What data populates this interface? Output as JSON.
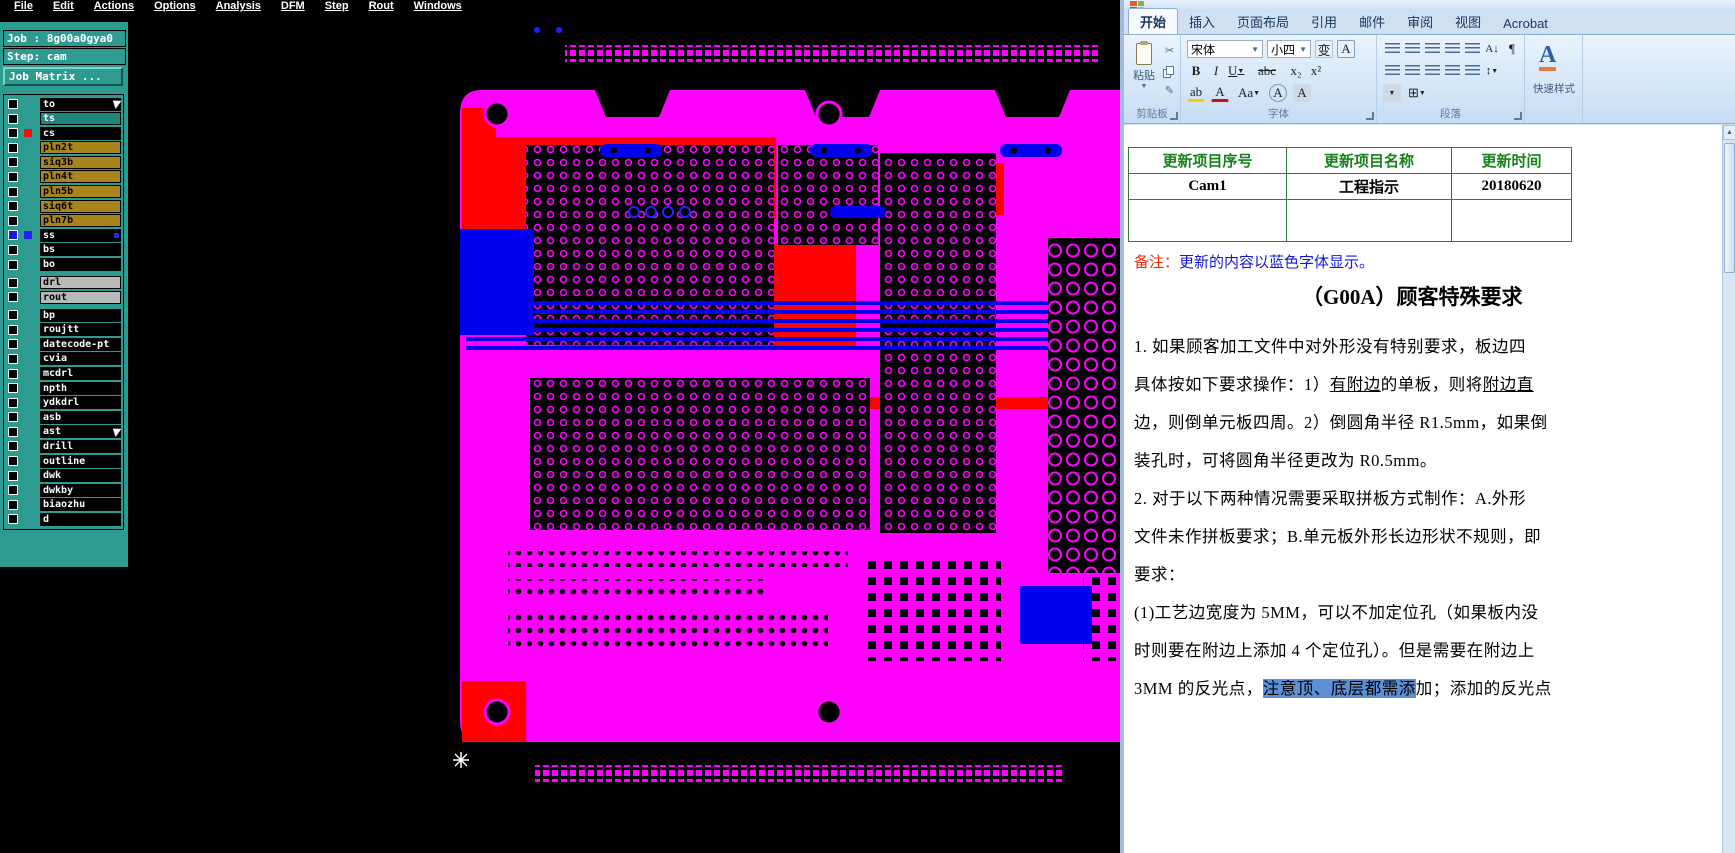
{
  "cam": {
    "menus": [
      "File",
      "Edit",
      "Actions",
      "Options",
      "Analysis",
      "DFM",
      "Step",
      "Rout",
      "Windows"
    ],
    "job": {
      "job_line": "Job : 8g00a0gya0",
      "step_line": "Step: cam",
      "matrix_label": "Job Matrix ..."
    },
    "layers": [
      {
        "name": "to",
        "type": "black",
        "cursor": true
      },
      {
        "name": "ts",
        "type": "teal"
      },
      {
        "name": "cs",
        "type": "black",
        "marker": true
      },
      {
        "name": "pln2t",
        "type": "gold"
      },
      {
        "name": "siq3b",
        "type": "gold"
      },
      {
        "name": "pln4t",
        "type": "gold"
      },
      {
        "name": "pln5b",
        "type": "gold"
      },
      {
        "name": "siq6t",
        "type": "gold"
      },
      {
        "name": "pln7b",
        "type": "gold"
      },
      {
        "name": "ss",
        "type": "black",
        "selected": true
      },
      {
        "name": "bs",
        "type": "black"
      },
      {
        "name": "bo",
        "type": "black"
      },
      {
        "name": "drl",
        "type": "gray",
        "gap": true
      },
      {
        "name": "rout",
        "type": "gray"
      },
      {
        "name": "bp",
        "type": "black",
        "gap": true
      },
      {
        "name": "roujtt",
        "type": "black"
      },
      {
        "name": "datecode-pt",
        "type": "black"
      },
      {
        "name": "cvia",
        "type": "black"
      },
      {
        "name": "mcdrl",
        "type": "black"
      },
      {
        "name": "npth",
        "type": "black"
      },
      {
        "name": "ydkdrl",
        "type": "black"
      },
      {
        "name": "asb",
        "type": "black"
      },
      {
        "name": "ast",
        "type": "black",
        "cursor": true
      },
      {
        "name": "drill",
        "type": "black"
      },
      {
        "name": "outline",
        "type": "black"
      },
      {
        "name": "dwk",
        "type": "black"
      },
      {
        "name": "dwkby",
        "type": "black"
      },
      {
        "name": "biaozhu",
        "type": "black"
      },
      {
        "name": "d",
        "type": "black"
      }
    ],
    "colors": {
      "sidebar_teal": "#2d9b8f",
      "layer_gold": "#a8851c",
      "layer_gray": "#b9b9b9",
      "pcb_magenta": "#ff00ff",
      "pcb_red": "#ff0000",
      "pcb_blue": "#0000ee"
    }
  },
  "word": {
    "tabs": [
      {
        "label": "开始",
        "active": true
      },
      {
        "label": "插入"
      },
      {
        "label": "页面布局"
      },
      {
        "label": "引用"
      },
      {
        "label": "邮件"
      },
      {
        "label": "审阅"
      },
      {
        "label": "视图"
      },
      {
        "label": "Acrobat"
      }
    ],
    "ribbon": {
      "paste_label": "粘贴",
      "font_name": "宋体",
      "font_size": "小四",
      "groups": [
        "剪贴板",
        "字体",
        "段落"
      ],
      "quick_style_label": "快速样式",
      "buttons": {
        "bold": "B",
        "italic": "I",
        "underline": "U",
        "strike": "abc",
        "subscript": "x₂",
        "superscript": "x²",
        "pinyin": "变",
        "char_border": "A",
        "highlight": "ab",
        "font_color": "A",
        "change_case": "Aa",
        "enclose": "A",
        "shading_char": "A"
      }
    },
    "table": {
      "headers": [
        "更新项目序号",
        "更新项目名称",
        "更新时间"
      ],
      "rows": [
        [
          "Cam1",
          "工程指示",
          "20180620"
        ],
        [
          "",
          "",
          ""
        ]
      ]
    },
    "note": {
      "prefix": "备注：",
      "body": "更新的内容以蓝色字体显示。"
    },
    "title": "（G00A）顾客特殊要求",
    "lines": {
      "l1": "1. 如果顾客加工文件中对外形没有特别要求，板边四",
      "l2a": "具体按如下要求操作：1）",
      "l2b": "有附边",
      "l2c": "的单板，则将",
      "l2d": "附边直",
      "l3": "边，则倒单元板四周。2）倒圆角半径 R1.5mm，如果倒",
      "l4": "装孔时，可将圆角半径更改为 R0.5mm。",
      "l5": "2. 对于以下两种情况需要采取拼板方式制作：A.外形",
      "l6": "文件未作拼板要求；B.单元板外形长边形状不规则，即",
      "l7": "要求：",
      "l8": "(1)工艺边宽度为 5MM，可以不加定位孔（如果板内没",
      "l9": "时则要在附边上添加 4 个定位孔）。但是需要在附边上",
      "l10a": "3MM 的反光点，",
      "l10b": "注意顶、底层都需添",
      "l10c": "加；添加的反光点"
    }
  }
}
